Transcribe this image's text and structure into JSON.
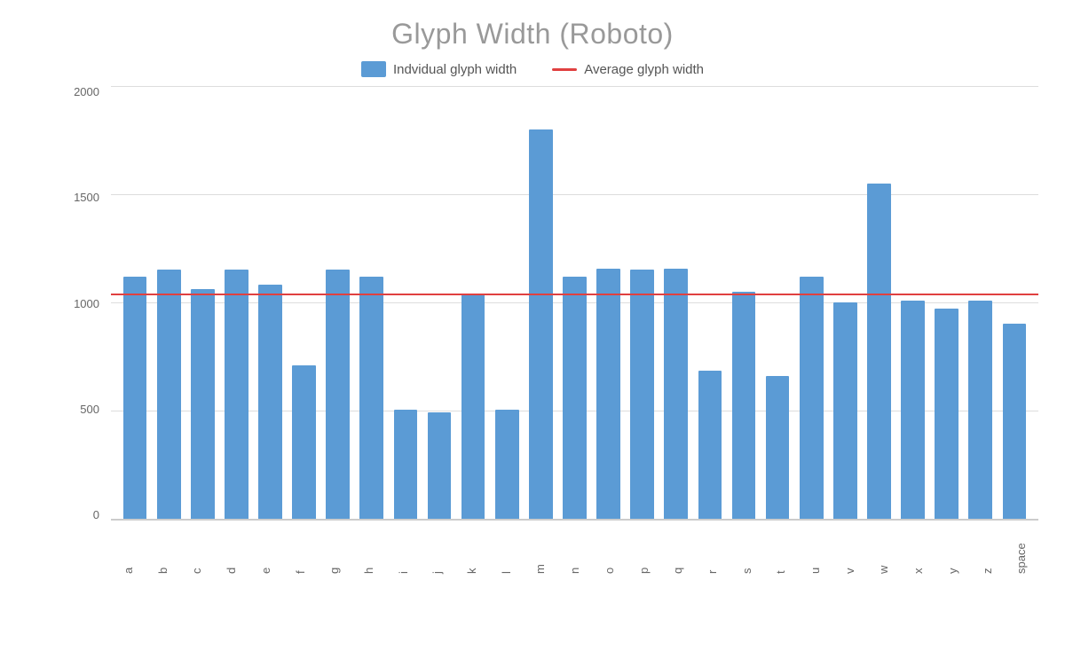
{
  "title": "Glyph Width (Roboto)",
  "legend": {
    "bar_label": "Indvidual glyph width",
    "line_label": "Average glyph width"
  },
  "chart": {
    "y_max": 2000,
    "y_labels": [
      "2000",
      "1500",
      "1000",
      "500",
      "0"
    ],
    "average_value": 1040,
    "bars": [
      {
        "label": "a",
        "value": 1120
      },
      {
        "label": "b",
        "value": 1150
      },
      {
        "label": "c",
        "value": 1060
      },
      {
        "label": "d",
        "value": 1150
      },
      {
        "label": "e",
        "value": 1080
      },
      {
        "label": "f",
        "value": 710
      },
      {
        "label": "g",
        "value": 1150
      },
      {
        "label": "h",
        "value": 1120
      },
      {
        "label": "i",
        "value": 505
      },
      {
        "label": "j",
        "value": 490
      },
      {
        "label": "k",
        "value": 1040
      },
      {
        "label": "l",
        "value": 505
      },
      {
        "label": "m",
        "value": 1800
      },
      {
        "label": "n",
        "value": 1120
      },
      {
        "label": "o",
        "value": 1155
      },
      {
        "label": "p",
        "value": 1150
      },
      {
        "label": "q",
        "value": 1155
      },
      {
        "label": "r",
        "value": 685
      },
      {
        "label": "s",
        "value": 1050
      },
      {
        "label": "t",
        "value": 660
      },
      {
        "label": "u",
        "value": 1120
      },
      {
        "label": "v",
        "value": 1000
      },
      {
        "label": "w",
        "value": 1550
      },
      {
        "label": "x",
        "value": 1010
      },
      {
        "label": "y",
        "value": 970
      },
      {
        "label": "z",
        "value": 1010
      },
      {
        "label": "space",
        "value": 900
      }
    ]
  }
}
